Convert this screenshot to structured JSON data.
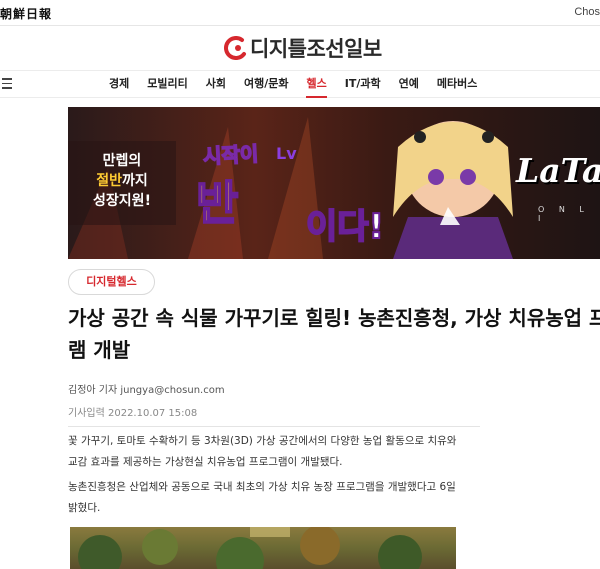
{
  "header": {
    "publisher_logo_text": "朝鮮日報",
    "right_text": "Chos",
    "brand_name": "디지틀조선일보"
  },
  "nav": {
    "items": [
      {
        "label": "경제"
      },
      {
        "label": "모빌리티"
      },
      {
        "label": "사회"
      },
      {
        "label": "여행/문화"
      },
      {
        "label": "헬스",
        "active": true
      },
      {
        "label": "IT/과학"
      },
      {
        "label": "연예"
      },
      {
        "label": "메타버스"
      }
    ]
  },
  "banner": {
    "left_line1": "만렙의",
    "left_line2_highlight": "절반",
    "left_line2_rest": "까지",
    "left_line3": "성장지원!",
    "slogan_top": "시작이",
    "slogan_big": "반",
    "slogan_end": "이다!",
    "lv_badge": "Lv",
    "game_logo": "LaTa",
    "game_sub": "O N L I"
  },
  "article": {
    "category": "디지털헬스",
    "title_line1": "가상 공간 속 식물 가꾸기로 힐링! 농촌진흥청, 가상 치유농업 프",
    "title_line2": "램 개발",
    "byline": "김정아 기자 jungya@chosun.com",
    "dateline": "기사입력 2022.10.07 15:08",
    "paragraph1": "꽃 가꾸기, 토마토 수확하기 등 3차원(3D) 가상 공간에서의 다양한 농업 활동으로 치유와 교감 효과를 제공하는 가상현실 치유농업 프로그램이 개발됐다.",
    "paragraph2": "농촌진흥청은 산업체와 공동으로 국내 최초의 가상 치유 농장 프로그램을 개발했다고 6일 밝혔다."
  },
  "colors": {
    "accent": "#d6282e",
    "text": "#222222"
  }
}
